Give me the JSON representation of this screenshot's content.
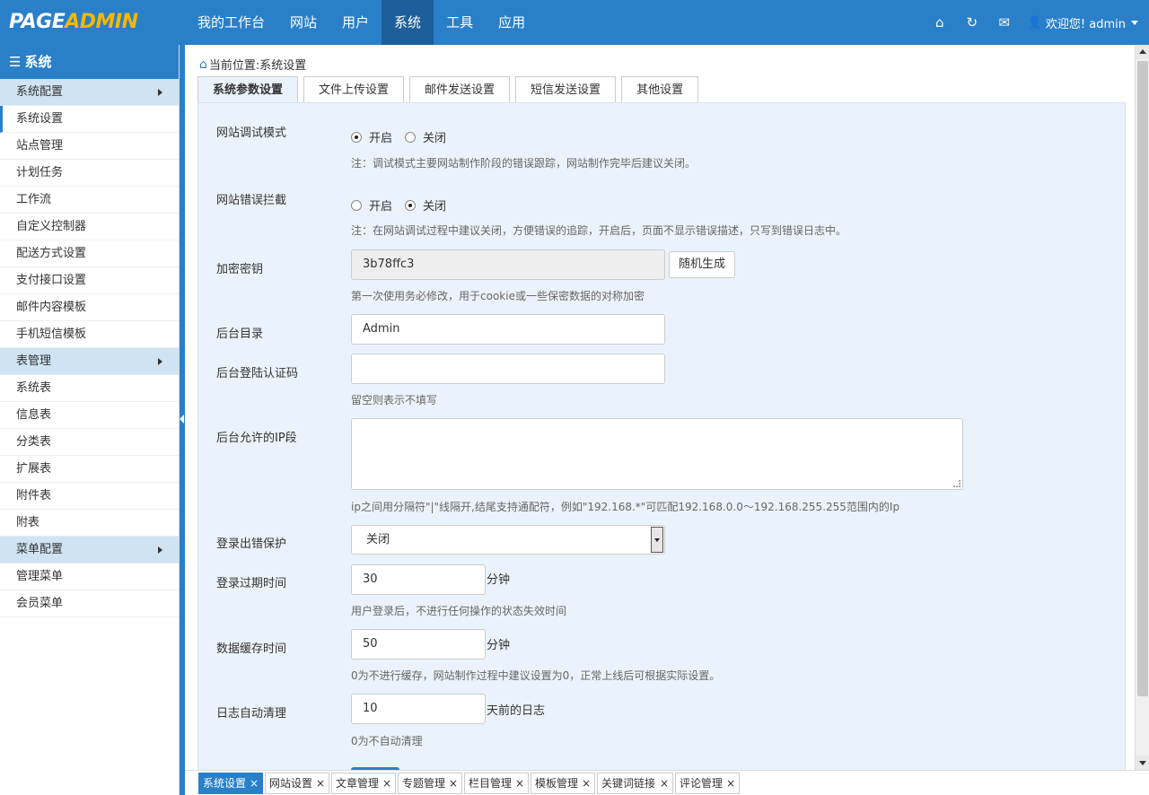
{
  "logo": {
    "part1": "PAGE",
    "part2": "ADMIN"
  },
  "topnav": [
    "我的工作台",
    "网站",
    "用户",
    "系统",
    "工具",
    "应用"
  ],
  "topnav_active": "系统",
  "user": {
    "greeting": "欢迎您! admin"
  },
  "icons": {
    "home": "home-icon",
    "refresh": "refresh-icon",
    "mail": "mail-icon",
    "user": "user-icon"
  },
  "sidebar": {
    "title": "系统",
    "groups": [
      {
        "label": "系统配置",
        "items": [
          "系统设置",
          "站点管理",
          "计划任务",
          "工作流",
          "自定义控制器",
          "配送方式设置",
          "支付接口设置",
          "邮件内容模板",
          "手机短信模板"
        ]
      },
      {
        "label": "表管理",
        "items": [
          "系统表",
          "信息表",
          "分类表",
          "扩展表",
          "附件表",
          "附表"
        ]
      },
      {
        "label": "菜单配置",
        "items": [
          "管理菜单",
          "会员菜单"
        ]
      }
    ],
    "active_item": "系统设置"
  },
  "breadcrumb": {
    "prefix": "当前位置:",
    "current": "系统设置"
  },
  "tabs": [
    "系统参数设置",
    "文件上传设置",
    "邮件发送设置",
    "短信发送设置",
    "其他设置"
  ],
  "active_tab": "系统参数设置",
  "form": {
    "debug": {
      "label": "网站调试模式",
      "on": "开启",
      "off": "关闭",
      "selected": "on",
      "note": "注：调试模式主要网站制作阶段的错误跟踪，网站制作完毕后建议关闭。"
    },
    "error_intercept": {
      "label": "网站错误拦截",
      "on": "开启",
      "off": "关闭",
      "selected": "off",
      "note": "注：在网站调试过程中建议关闭，方便错误的追踪，开启后，页面不显示错误描述，只写到错误日志中。"
    },
    "secret_key": {
      "label": "加密密钥",
      "value": "3b78ffc3",
      "button": "随机生成",
      "note": "第一次使用务必修改，用于cookie或一些保密数据的对称加密"
    },
    "admin_dir": {
      "label": "后台目录",
      "value": "Admin"
    },
    "login_code": {
      "label": "后台登陆认证码",
      "value": "",
      "note": "留空则表示不填写"
    },
    "allowed_ip": {
      "label": "后台允许的IP段",
      "value": "",
      "note": "ip之间用分隔符\"|\"线隔开,结尾支持通配符，例如\"192.168.*\"可匹配192.168.0.0～192.168.255.255范围内的Ip"
    },
    "login_protect": {
      "label": "登录出错保护",
      "selected": "关闭"
    },
    "login_expire": {
      "label": "登录过期时间",
      "value": "30",
      "unit": "分钟",
      "note": "用户登录后，不进行任何操作的状态失效时间"
    },
    "cache_time": {
      "label": "数据缓存时间",
      "value": "50",
      "unit": "分钟",
      "note": "0为不进行缓存，网站制作过程中建议设置为0，正常上线后可根据实际设置。"
    },
    "log_clean": {
      "label": "日志自动清理",
      "value": "10",
      "unit": "天前的日志",
      "note": "0为不自动清理"
    }
  },
  "bottom_tabs": [
    "系统设置",
    "网站设置",
    "文章管理",
    "专题管理",
    "栏目管理",
    "模板管理",
    "关键词链接",
    "评论管理"
  ],
  "bottom_close": "×",
  "colors": {
    "brand": "#2a7fc9",
    "accent": "#f5b800",
    "panel": "#eaf3fb"
  }
}
